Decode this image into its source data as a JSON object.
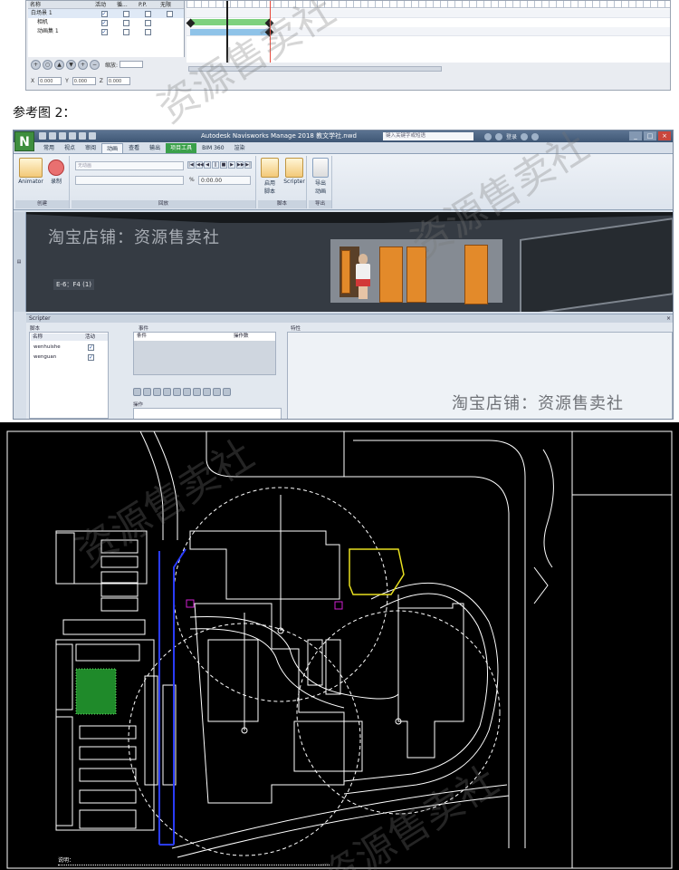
{
  "animator": {
    "tree_headers": [
      "名称",
      "活动",
      "循...",
      "P.P.",
      "无限"
    ],
    "rows": [
      {
        "name": "白场景 1",
        "checks": [
          true,
          false,
          false,
          false
        ]
      },
      {
        "name": "相机",
        "checks": [
          true,
          false,
          false,
          false
        ]
      },
      {
        "name": "动画集 1",
        "checks": [
          true,
          false,
          false,
          false
        ]
      }
    ],
    "zoom_label": "缩放:",
    "field_x_label": "X",
    "field_y_label": "Y",
    "field_z_label": "Z",
    "field_value": "0.000"
  },
  "ref_label": "参考图 2：",
  "navisworks": {
    "logo": "N",
    "title": "Autodesk Navisworks Manage 2018   教文学社.nwd",
    "search_placeholder": "键入关键字或短语",
    "user_label": "登录",
    "tabs": [
      "常用",
      "视点",
      "审阅",
      "动画",
      "查看",
      "输出",
      "项目工具",
      "BIM 360",
      "渲染"
    ],
    "active_tab": "动画",
    "highlighted_tab": "项目工具",
    "ribbon": {
      "animator_label": "Animator",
      "record_label": "录制",
      "create_group": "创建",
      "playback_group": "回放",
      "script_group": "脚本",
      "export_group": "导出",
      "placeholder_anim": "无动画",
      "placeholder_field": "",
      "time_value": "0:00.00",
      "pct": "%",
      "enable_script": "启用\n脚本",
      "scripter_label": "Scripter",
      "export_anim": "导出\n动画"
    },
    "viewport": {
      "watermark": "淘宝店铺：资源售卖社",
      "view_label": "E-6：F4 (1)"
    },
    "scripter": {
      "title": "Scripter",
      "scripts_label": "脚本",
      "col_name": "名称",
      "col_active": "活动",
      "scripts": [
        {
          "name": "wenhuishe",
          "active": true
        },
        {
          "name": "wenguan",
          "active": true
        }
      ],
      "events_label": "事件",
      "cond_col": "条件",
      "op_col": "操作数",
      "actions_label": "操作",
      "props_label": "特性",
      "watermark": "淘宝店铺：资源售卖社"
    }
  },
  "cad": {
    "note_title": "说明："
  },
  "watermark_text": "资源售卖社",
  "colors": {
    "accent_green": "#3aa04a",
    "cad_background": "#000000",
    "cad_line": "#ffffff",
    "cad_blue": "#2a3cff",
    "cad_yellow": "#e8e020",
    "cad_magenta": "#d020d0"
  }
}
